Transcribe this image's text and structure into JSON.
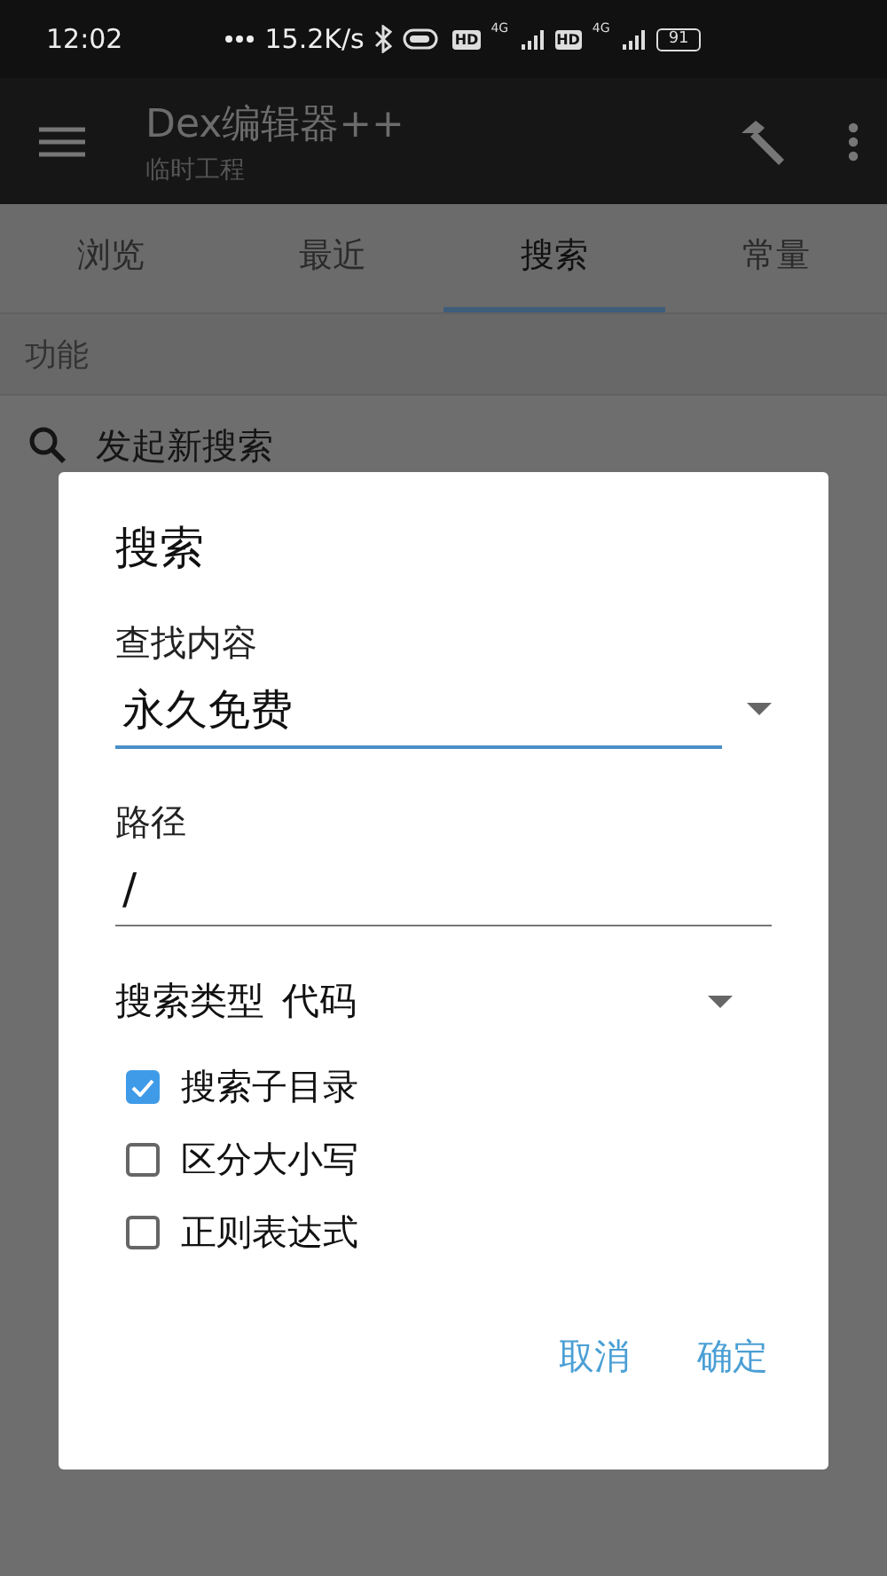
{
  "status_bar": {
    "time": "12:02",
    "net_speed": "15.2K/s",
    "sims": [
      {
        "hd": "HD",
        "network": "4G"
      },
      {
        "hd": "HD",
        "network": "4G"
      }
    ],
    "battery": "91"
  },
  "app_bar": {
    "title": "Dex编辑器++",
    "subtitle": "临时工程"
  },
  "tabs": [
    {
      "label": "浏览",
      "selected": false
    },
    {
      "label": "最近",
      "selected": false
    },
    {
      "label": "搜索",
      "selected": true
    },
    {
      "label": "常量",
      "selected": false
    }
  ],
  "section": {
    "header": "功能",
    "items": [
      {
        "label": "发起新搜索"
      }
    ]
  },
  "dialog": {
    "title": "搜索",
    "find_label": "查找内容",
    "find_value": "永久免费",
    "path_label": "路径",
    "path_value": "/",
    "search_type_label": "搜索类型",
    "search_type_value": "代码",
    "options": [
      {
        "label": "搜索子目录",
        "checked": true
      },
      {
        "label": "区分大小写",
        "checked": false
      },
      {
        "label": "正则表达式",
        "checked": false
      }
    ],
    "buttons": [
      "取消",
      "确定"
    ]
  }
}
